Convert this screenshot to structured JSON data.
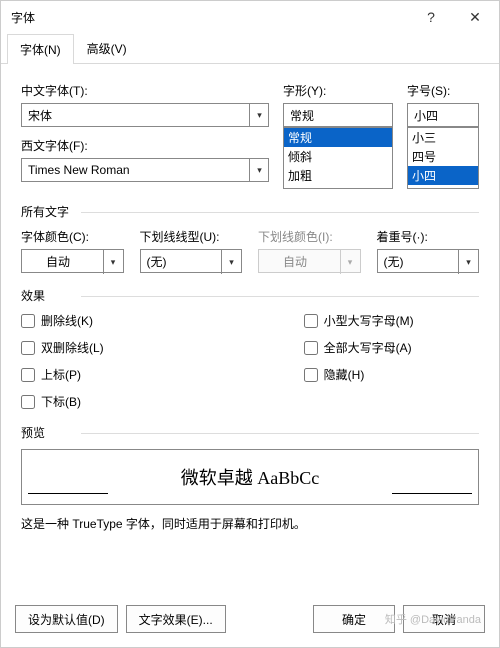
{
  "window": {
    "title": "字体",
    "help": "?",
    "close": "✕"
  },
  "tabs": {
    "font": "字体(N)",
    "advanced": "高级(V)"
  },
  "labels": {
    "chinese_font": "中文字体(T):",
    "western_font": "西文字体(F):",
    "style": "字形(Y):",
    "size": "字号(S):",
    "all_text": "所有文字",
    "font_color": "字体颜色(C):",
    "underline_style": "下划线线型(U):",
    "underline_color": "下划线颜色(I):",
    "emphasis": "着重号(·):",
    "effects": "效果",
    "preview": "预览"
  },
  "values": {
    "chinese_font": "宋体",
    "western_font": "Times New Roman",
    "style": "常规",
    "size": "小四",
    "font_color": "自动",
    "underline_style": "(无)",
    "underline_color": "自动",
    "emphasis": "(无)"
  },
  "style_options": [
    "常规",
    "倾斜",
    "加粗"
  ],
  "style_selected": "常规",
  "size_options": [
    "小三",
    "四号",
    "小四"
  ],
  "size_selected": "小四",
  "effects": {
    "strike": "删除线(K)",
    "dblstrike": "双删除线(L)",
    "superscript": "上标(P)",
    "subscript": "下标(B)",
    "smallcaps": "小型大写字母(M)",
    "allcaps": "全部大写字母(A)",
    "hidden": "隐藏(H)"
  },
  "preview_text": "微软卓越 AaBbCc",
  "hint_text": "这是一种 TrueType 字体，同时适用于屏幕和打印机。",
  "buttons": {
    "default": "设为默认值(D)",
    "text_effects": "文字效果(E)...",
    "ok": "确定",
    "cancel": "取消"
  },
  "watermark": "知乎 @DavidPanda"
}
